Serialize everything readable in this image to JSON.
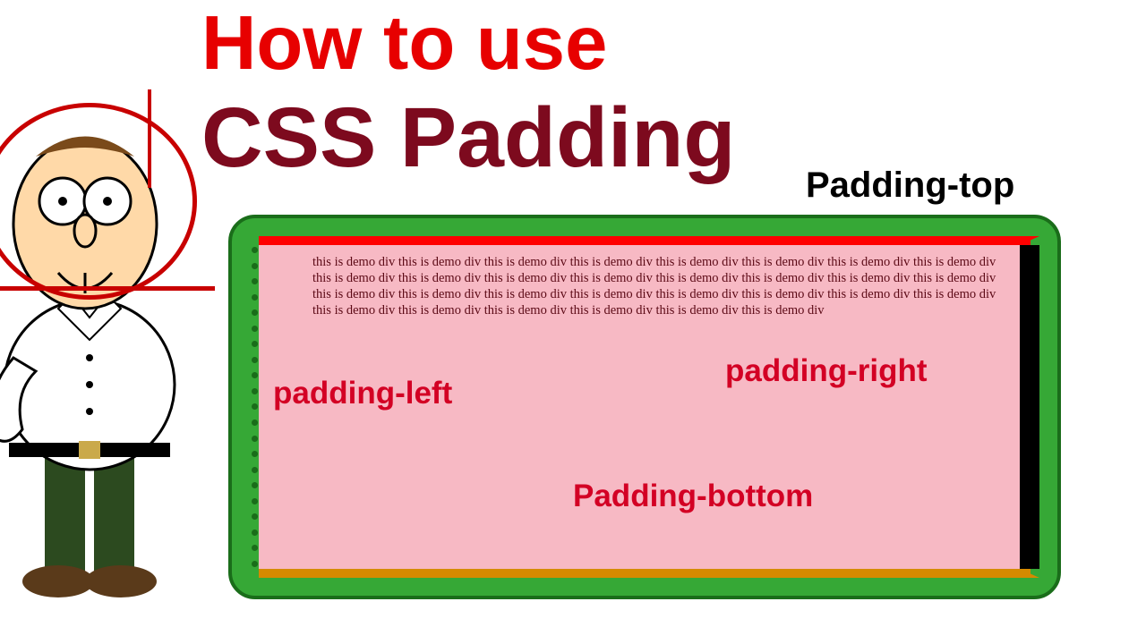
{
  "title": {
    "line1": "How to use",
    "line2": "CSS Padding"
  },
  "labels": {
    "top": "Padding-top",
    "left": "padding-left",
    "right": "padding-right",
    "bottom": "Padding-bottom"
  },
  "demo_text": "this is demo div this is demo div this is demo div this is demo div this is demo div this is demo div this is demo div this is demo div this is demo div this is demo div this is demo div this is demo div this is demo div this is demo div this is demo div this is demo div this is demo div this is demo div this is demo div this is demo div this is demo div this is demo div this is demo div this is demo div this is demo div this is demo div this is demo div this is demo div this is demo div this is demo div",
  "colors": {
    "title1": "#e70000",
    "title2": "#7d0a1e",
    "label": "#d30024",
    "green": "#36a836",
    "green_border": "#1a6d1a",
    "pink": "#f7b9c4",
    "red_edge": "#ff0000",
    "bottom_edge": "#d58a00"
  }
}
